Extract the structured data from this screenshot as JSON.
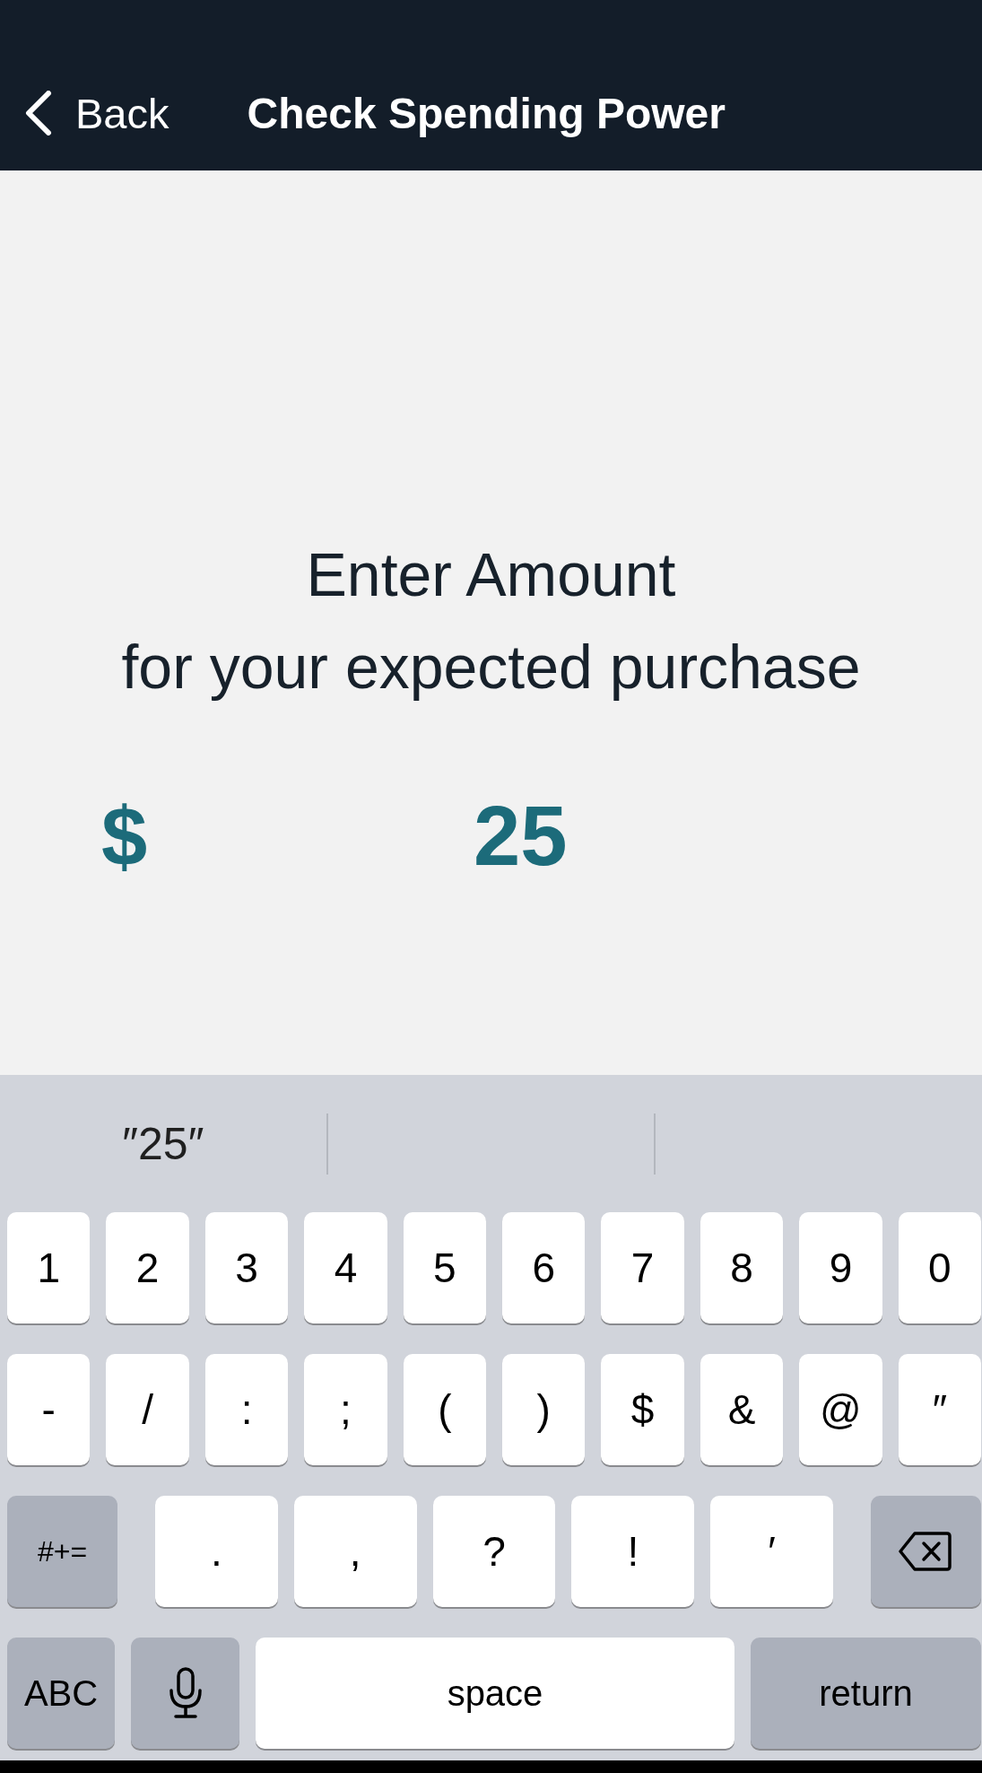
{
  "nav_bar": {
    "back_label": "Back",
    "title": "Check Spending Power"
  },
  "prompt": {
    "heading": "Enter Amount",
    "subheading": "for your expected purchase"
  },
  "amount": {
    "currency": "$",
    "value": "25"
  },
  "keyboard": {
    "suggestions": [
      "″25″"
    ],
    "rows": [
      {
        "keys": [
          {
            "kind": "character",
            "label": "1"
          },
          {
            "kind": "character",
            "label": "2"
          },
          {
            "kind": "character",
            "label": "3"
          },
          {
            "kind": "character",
            "label": "4"
          },
          {
            "kind": "character",
            "label": "5"
          },
          {
            "kind": "character",
            "label": "6"
          },
          {
            "kind": "character",
            "label": "7"
          },
          {
            "kind": "character",
            "label": "8"
          },
          {
            "kind": "character",
            "label": "9"
          },
          {
            "kind": "character",
            "label": "0"
          }
        ]
      },
      {
        "keys": [
          {
            "kind": "character",
            "label": "-"
          },
          {
            "kind": "character",
            "label": "/"
          },
          {
            "kind": "character",
            "label": ":"
          },
          {
            "kind": "character",
            "label": ";"
          },
          {
            "kind": "character",
            "label": "("
          },
          {
            "kind": "character",
            "label": ")"
          },
          {
            "kind": "character",
            "label": "$"
          },
          {
            "kind": "character",
            "label": "&"
          },
          {
            "kind": "character",
            "label": "@"
          },
          {
            "kind": "character",
            "label": "″"
          }
        ]
      },
      {
        "keys": [
          {
            "kind": "mode",
            "label": "#+="
          },
          {
            "kind": "character",
            "label": "."
          },
          {
            "kind": "character",
            "label": ","
          },
          {
            "kind": "character",
            "label": "?"
          },
          {
            "kind": "character",
            "label": "!"
          },
          {
            "kind": "character",
            "label": "′"
          },
          {
            "kind": "delete"
          }
        ]
      },
      {
        "keys": [
          {
            "kind": "mode",
            "label": "ABC"
          },
          {
            "kind": "dictation"
          },
          {
            "kind": "space",
            "label": "space"
          },
          {
            "kind": "return",
            "label": "return"
          }
        ]
      }
    ]
  }
}
